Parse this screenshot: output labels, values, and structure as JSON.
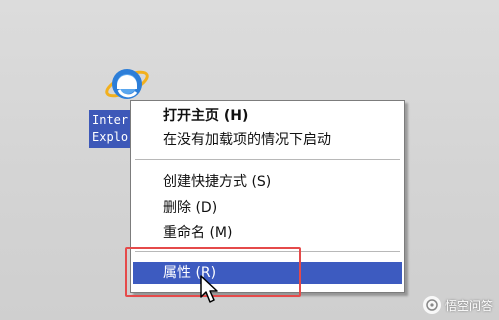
{
  "desktop": {
    "icon_label_lines": [
      "Inter",
      "Explo"
    ]
  },
  "context_menu": {
    "items": [
      {
        "label": "打开主页 (H)",
        "bold": true
      },
      {
        "label": "在没有加载项的情况下启动",
        "bold": false
      },
      {
        "label": "创建快捷方式 (S)",
        "bold": false
      },
      {
        "label": "删除 (D)",
        "bold": false
      },
      {
        "label": "重命名 (M)",
        "bold": false
      },
      {
        "label": "属性 (R)",
        "bold": false,
        "selected": true
      }
    ]
  },
  "watermark": {
    "text": "悟空问答"
  },
  "colors": {
    "selection": "#3d5bc0",
    "highlight_border": "#e54a4a"
  }
}
